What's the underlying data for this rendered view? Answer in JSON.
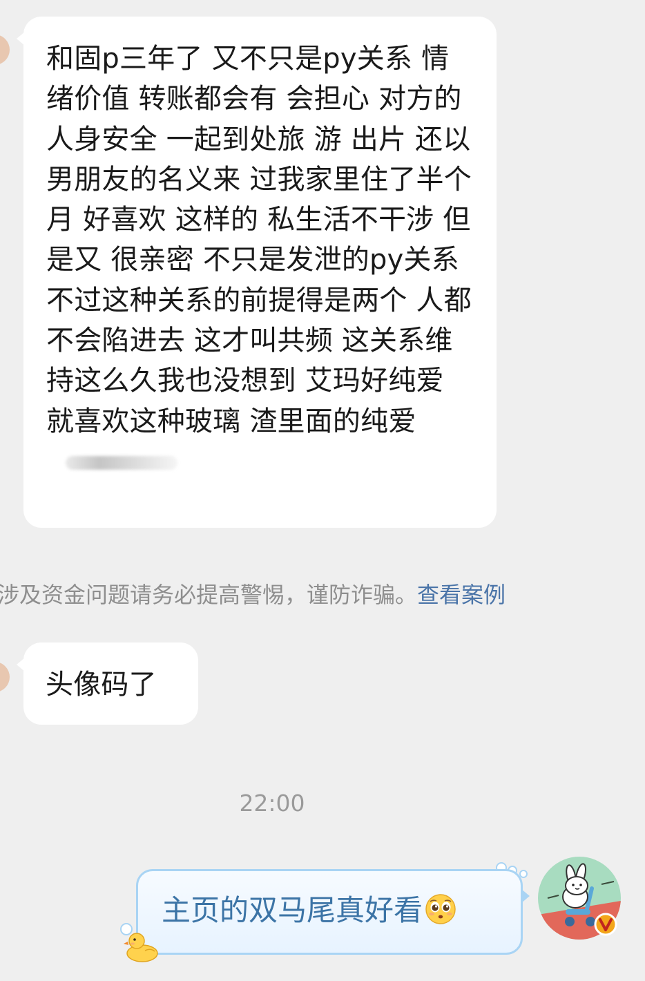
{
  "messages": [
    {
      "sender": "other",
      "text": "和固p三年了 又不只是py关系 情绪价值 转账都会有 会担心 对方的人身安全 一起到处旅 游 出片 还以男朋友的名义来 过我家里住了半个月  好喜欢 这样的 私生活不干涉 但是又 很亲密 不只是发泄的py关系 不过这种关系的前提得是两个 人都不会陷进去 这才叫共频 这关系维持这么久我也没想到 艾玛好纯爱 就喜欢这种玻璃 渣里面的纯爱"
    },
    {
      "sender": "other",
      "text": "头像码了"
    },
    {
      "sender": "me",
      "text": "主页的双马尾真好看",
      "emoji": "pleading-face-emoji"
    }
  ],
  "notice": {
    "text": "涉及资金问题请务必提高警惕，谨防诈骗。",
    "link": "查看案例"
  },
  "timestamp": "22:00",
  "icons": {
    "blurred_signature": "blurred-signature",
    "emoji": "pleading-face-emoji",
    "duck": "duck-sticker-icon",
    "avatar": "bunny-avatar",
    "verified": "verified-v-badge-icon"
  },
  "colors": {
    "background": "#efefef",
    "bubble_in": "#ffffff",
    "bubble_out_border": "#a9d4f4",
    "bubble_out_text": "#3c74a6",
    "notice_text": "#8e8e8e",
    "link": "#4a74a8",
    "verified_badge": "#f3a51a"
  }
}
